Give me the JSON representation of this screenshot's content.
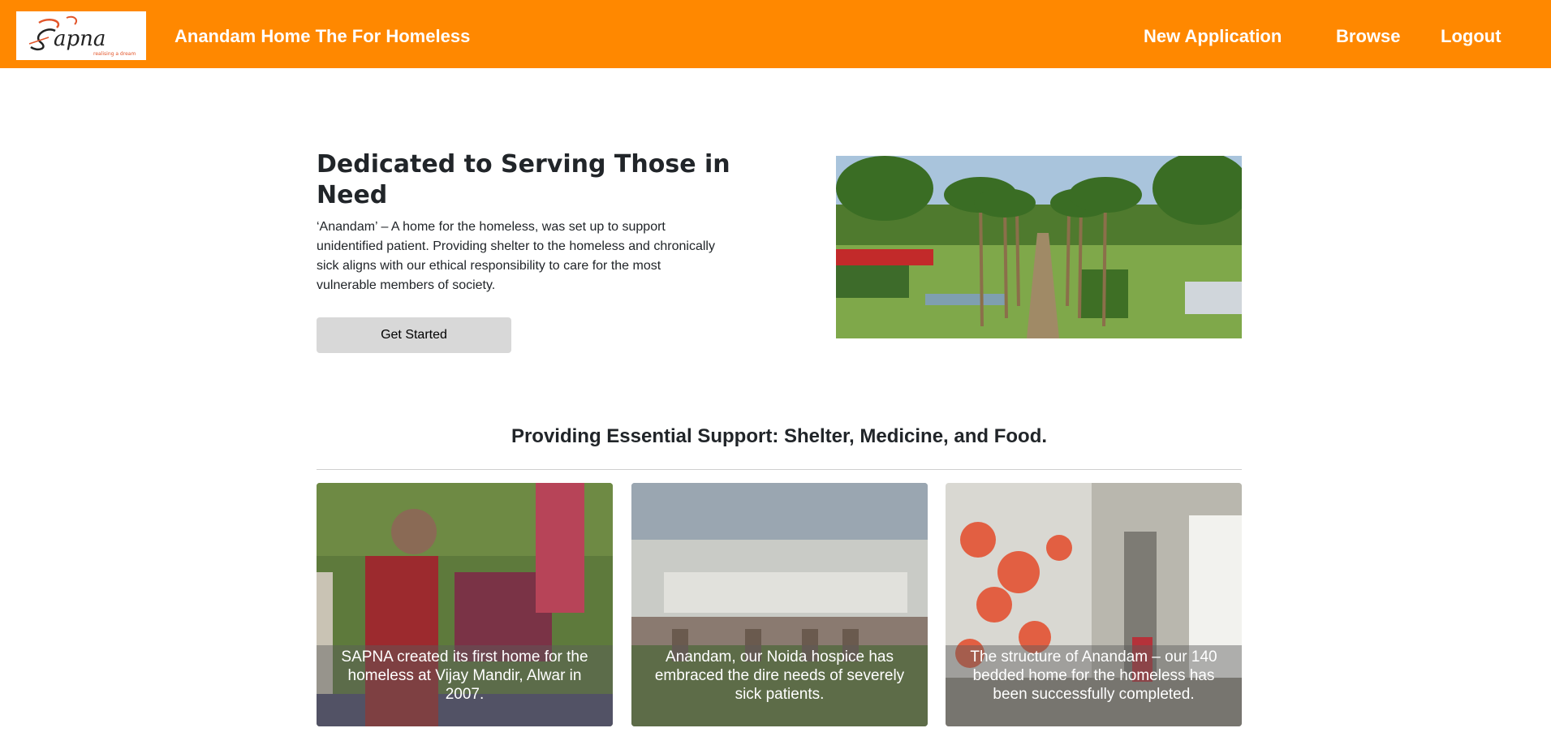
{
  "header": {
    "logo_text": "Sapna",
    "logo_tagline": "realising a dream",
    "title": "Anandam Home The For Homeless",
    "nav": {
      "new_application": "New Application",
      "browse": "Browse",
      "logout": "Logout"
    }
  },
  "hero": {
    "title": "Dedicated to Serving Those in Need",
    "text": "‘Anandam’ – A home for the homeless, was set up to support unidentified patient. Providing shelter to the homeless and chronically sick aligns with our ethical responsibility to care for the most vulnerable members of society.",
    "button": "Get Started"
  },
  "section": {
    "heading": "Providing Essential Support: Shelter, Medicine, and Food."
  },
  "cards": [
    {
      "caption": "SAPNA created its first home for the homeless at Vijay Mandir, Alwar in 2007."
    },
    {
      "caption": "Anandam, our Noida hospice has embraced the dire needs of severely sick patients."
    },
    {
      "caption": "The structure of Anandam – our 140 bedded home for the homeless has been successfully completed."
    }
  ],
  "colors": {
    "navbar": "#ff8800",
    "button": "#d8d8d8"
  }
}
